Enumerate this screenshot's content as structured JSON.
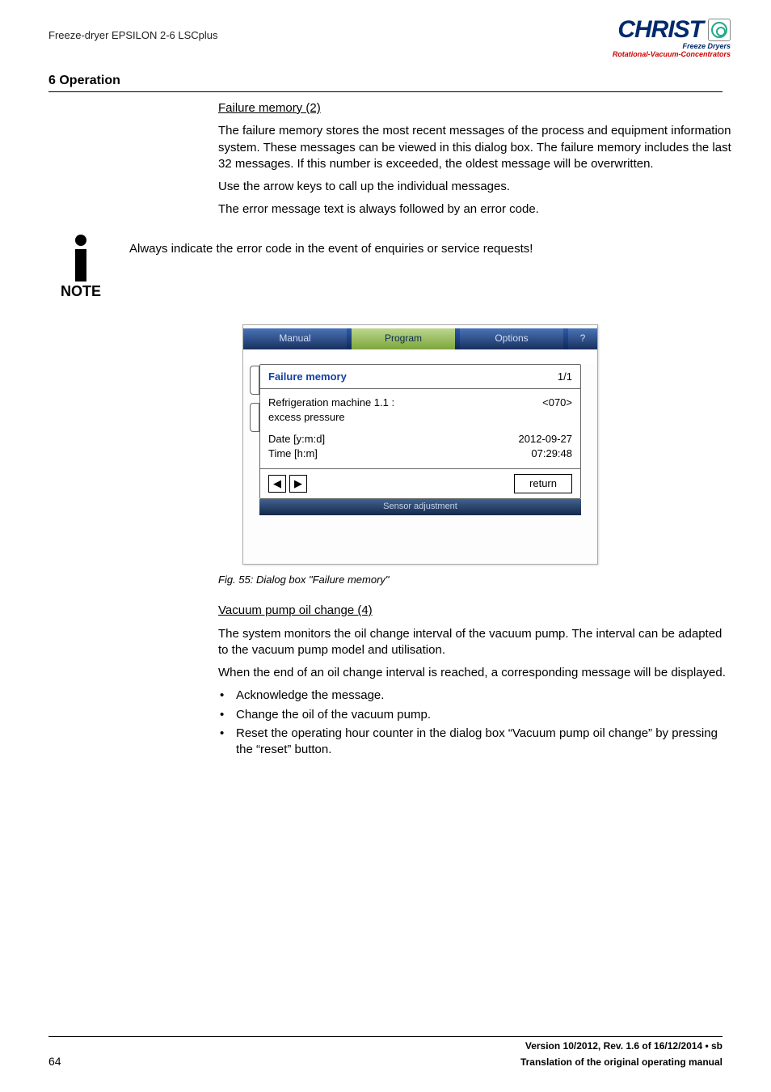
{
  "doc_header": "Freeze-dryer EPSILON 2-6 LSCplus",
  "section_number_title": "6 Operation",
  "logo": {
    "name": "CHRIST",
    "sub1": "Freeze Dryers",
    "sub2": "Rotational-Vacuum-Concentrators"
  },
  "failure_memory": {
    "heading": "Failure memory (2)",
    "p1": "The failure memory stores the most recent messages of the process and equipment information system. These messages can be viewed in this dialog box. The failure memory includes the last 32 messages. If this number is exceeded, the oldest message will be overwritten.",
    "p2": "Use the arrow keys to call up the individual messages.",
    "p3": "The error message text is always followed by an error code."
  },
  "note": {
    "label": "NOTE",
    "text": "Always indicate the error code in the event of enquiries or service requests!"
  },
  "dialog": {
    "tabs": {
      "manual": "Manual",
      "program": "Program",
      "options": "Options",
      "help": "?"
    },
    "panel_title": "Failure memory",
    "page_indicator": "1/1",
    "msg_line1": "Refrigeration machine 1.1 :",
    "msg_line2": "excess pressure",
    "msg_code": "<070>",
    "date_label": "Date [y:m:d]",
    "time_label": "Time [h:m]",
    "date_value": "2012-09-27",
    "time_value": "07:29:48",
    "prev_glyph": "◀",
    "next_glyph": "▶",
    "return_label": "return",
    "ghost_tab": "Sensor adjustment"
  },
  "fig_caption": "Fig. 55: Dialog box \"Failure memory\"",
  "vacuum": {
    "heading": "Vacuum pump oil change (4)",
    "p1": "The system monitors the oil change interval of the vacuum pump. The interval can be adapted to the vacuum pump model and utilisation.",
    "p2": "When the end of an oil change interval is reached, a corresponding message will be displayed.",
    "bullets": [
      "Acknowledge the message.",
      "Change the oil of the vacuum pump.",
      "Reset the operating hour counter in the dialog box “Vacuum pump oil change” by pressing the “reset” button."
    ]
  },
  "footer": {
    "page": "64",
    "version": "Version 10/2012, Rev. 1.6 of 16/12/2014 • sb",
    "subtitle": "Translation of the original operating manual"
  }
}
